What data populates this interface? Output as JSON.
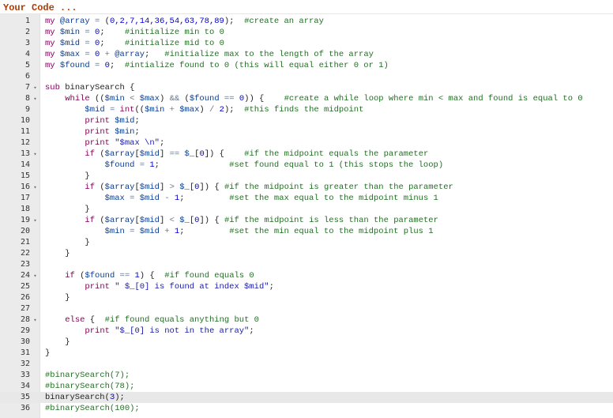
{
  "title": "Your Code ...",
  "active_line": 35,
  "colors": {
    "title": "#b33a00",
    "gutter": "#ebebeb",
    "keyword": "#7f0055",
    "variable": "#0a3d91",
    "number": "#0000cd",
    "comment": "#236e24",
    "string": "#1a1aa6",
    "active_line": "#e8e8e8"
  },
  "lines": [
    {
      "n": "1",
      "fold": false,
      "indent": "",
      "tokens": [
        [
          "kw",
          "my "
        ],
        [
          "var",
          "@array"
        ],
        [
          "op",
          " = "
        ],
        [
          "plain",
          "("
        ],
        [
          "num",
          "0,2,7,14,36,54,63,78,89"
        ],
        [
          "plain",
          ");  "
        ],
        [
          "cmt",
          "#create an array"
        ]
      ]
    },
    {
      "n": "2",
      "fold": false,
      "indent": "",
      "tokens": [
        [
          "kw",
          "my "
        ],
        [
          "var",
          "$min"
        ],
        [
          "op",
          " = "
        ],
        [
          "num",
          "0"
        ],
        [
          "plain",
          ";    "
        ],
        [
          "cmt",
          "#initialize min to 0"
        ]
      ]
    },
    {
      "n": "3",
      "fold": false,
      "indent": "",
      "tokens": [
        [
          "kw",
          "my "
        ],
        [
          "var",
          "$mid"
        ],
        [
          "op",
          " = "
        ],
        [
          "num",
          "0"
        ],
        [
          "plain",
          ";    "
        ],
        [
          "cmt",
          "#initialize mid to 0"
        ]
      ]
    },
    {
      "n": "4",
      "fold": false,
      "indent": "",
      "tokens": [
        [
          "kw",
          "my "
        ],
        [
          "var",
          "$max"
        ],
        [
          "op",
          " = "
        ],
        [
          "num",
          "0"
        ],
        [
          "op",
          " + "
        ],
        [
          "var",
          "@array"
        ],
        [
          "plain",
          ";   "
        ],
        [
          "cmt",
          "#initialize max to the length of the array"
        ]
      ]
    },
    {
      "n": "5",
      "fold": false,
      "indent": "",
      "tokens": [
        [
          "kw",
          "my "
        ],
        [
          "var",
          "$found"
        ],
        [
          "op",
          " = "
        ],
        [
          "num",
          "0"
        ],
        [
          "plain",
          ";  "
        ],
        [
          "cmt",
          "#intialize found to 0 (this will equal either 0 or 1)"
        ]
      ]
    },
    {
      "n": "6",
      "fold": false,
      "indent": "",
      "tokens": []
    },
    {
      "n": "7",
      "fold": true,
      "indent": "",
      "tokens": [
        [
          "kw",
          "sub "
        ],
        [
          "fn",
          "binarySearch "
        ],
        [
          "plain",
          "{"
        ]
      ]
    },
    {
      "n": "8",
      "fold": true,
      "indent": "    ",
      "tokens": [
        [
          "kw",
          "while "
        ],
        [
          "plain",
          "(("
        ],
        [
          "var",
          "$min"
        ],
        [
          "op",
          " < "
        ],
        [
          "var",
          "$max"
        ],
        [
          "plain",
          ") "
        ],
        [
          "op",
          "&&"
        ],
        [
          "plain",
          " ("
        ],
        [
          "var",
          "$found"
        ],
        [
          "op",
          " == "
        ],
        [
          "num",
          "0"
        ],
        [
          "plain",
          ")) {    "
        ],
        [
          "cmt",
          "#create a while loop where min < max and found is equal to 0"
        ]
      ]
    },
    {
      "n": "9",
      "fold": false,
      "indent": "        ",
      "tokens": [
        [
          "var",
          "$mid"
        ],
        [
          "op",
          " = "
        ],
        [
          "kw",
          "int"
        ],
        [
          "plain",
          "(("
        ],
        [
          "var",
          "$min"
        ],
        [
          "op",
          " + "
        ],
        [
          "var",
          "$max"
        ],
        [
          "plain",
          ") "
        ],
        [
          "op",
          "/"
        ],
        [
          "num",
          " 2"
        ],
        [
          "plain",
          ");  "
        ],
        [
          "cmt",
          "#this finds the midpoint"
        ]
      ]
    },
    {
      "n": "10",
      "fold": false,
      "indent": "        ",
      "tokens": [
        [
          "kw",
          "print "
        ],
        [
          "var",
          "$mid"
        ],
        [
          "plain",
          ";"
        ]
      ]
    },
    {
      "n": "11",
      "fold": false,
      "indent": "        ",
      "tokens": [
        [
          "kw",
          "print "
        ],
        [
          "var",
          "$min"
        ],
        [
          "plain",
          ";"
        ]
      ]
    },
    {
      "n": "12",
      "fold": false,
      "indent": "        ",
      "tokens": [
        [
          "kw",
          "print "
        ],
        [
          "str",
          "\"$max \\n\""
        ],
        [
          "plain",
          ";"
        ]
      ]
    },
    {
      "n": "13",
      "fold": true,
      "indent": "        ",
      "tokens": [
        [
          "kw",
          "if "
        ],
        [
          "plain",
          "("
        ],
        [
          "var",
          "$array"
        ],
        [
          "plain",
          "["
        ],
        [
          "var",
          "$mid"
        ],
        [
          "plain",
          "]"
        ],
        [
          "op",
          " == "
        ],
        [
          "var",
          "$_"
        ],
        [
          "plain",
          "["
        ],
        [
          "num",
          "0"
        ],
        [
          "plain",
          "]) {    "
        ],
        [
          "cmt",
          "#if the midpoint equals the parameter"
        ]
      ]
    },
    {
      "n": "14",
      "fold": false,
      "indent": "            ",
      "tokens": [
        [
          "var",
          "$found"
        ],
        [
          "op",
          " = "
        ],
        [
          "num",
          "1"
        ],
        [
          "plain",
          ";              "
        ],
        [
          "cmt",
          "#set found equal to 1 (this stops the loop)"
        ]
      ]
    },
    {
      "n": "15",
      "fold": false,
      "indent": "        ",
      "tokens": [
        [
          "plain",
          "}"
        ]
      ]
    },
    {
      "n": "16",
      "fold": true,
      "indent": "        ",
      "tokens": [
        [
          "kw",
          "if "
        ],
        [
          "plain",
          "("
        ],
        [
          "var",
          "$array"
        ],
        [
          "plain",
          "["
        ],
        [
          "var",
          "$mid"
        ],
        [
          "plain",
          "]"
        ],
        [
          "op",
          " > "
        ],
        [
          "var",
          "$_"
        ],
        [
          "plain",
          "["
        ],
        [
          "num",
          "0"
        ],
        [
          "plain",
          "]) { "
        ],
        [
          "cmt",
          "#if the midpoint is greater than the parameter"
        ]
      ]
    },
    {
      "n": "17",
      "fold": false,
      "indent": "            ",
      "tokens": [
        [
          "var",
          "$max"
        ],
        [
          "op",
          " = "
        ],
        [
          "var",
          "$mid"
        ],
        [
          "op",
          " - "
        ],
        [
          "num",
          "1"
        ],
        [
          "plain",
          ";         "
        ],
        [
          "cmt",
          "#set the max equal to the midpoint minus 1"
        ]
      ]
    },
    {
      "n": "18",
      "fold": false,
      "indent": "        ",
      "tokens": [
        [
          "plain",
          "}"
        ]
      ]
    },
    {
      "n": "19",
      "fold": true,
      "indent": "        ",
      "tokens": [
        [
          "kw",
          "if "
        ],
        [
          "plain",
          "("
        ],
        [
          "var",
          "$array"
        ],
        [
          "plain",
          "["
        ],
        [
          "var",
          "$mid"
        ],
        [
          "plain",
          "]"
        ],
        [
          "op",
          " < "
        ],
        [
          "var",
          "$_"
        ],
        [
          "plain",
          "["
        ],
        [
          "num",
          "0"
        ],
        [
          "plain",
          "]) { "
        ],
        [
          "cmt",
          "#if the midpoint is less than the parameter"
        ]
      ]
    },
    {
      "n": "20",
      "fold": false,
      "indent": "            ",
      "tokens": [
        [
          "var",
          "$min"
        ],
        [
          "op",
          " = "
        ],
        [
          "var",
          "$mid"
        ],
        [
          "op",
          " + "
        ],
        [
          "num",
          "1"
        ],
        [
          "plain",
          ";         "
        ],
        [
          "cmt",
          "#set the min equal to the midpoint plus 1"
        ]
      ]
    },
    {
      "n": "21",
      "fold": false,
      "indent": "        ",
      "tokens": [
        [
          "plain",
          "}"
        ]
      ]
    },
    {
      "n": "22",
      "fold": false,
      "indent": "    ",
      "tokens": [
        [
          "plain",
          "}"
        ]
      ]
    },
    {
      "n": "23",
      "fold": false,
      "indent": "",
      "tokens": []
    },
    {
      "n": "24",
      "fold": true,
      "indent": "    ",
      "tokens": [
        [
          "kw",
          "if "
        ],
        [
          "plain",
          "("
        ],
        [
          "var",
          "$found"
        ],
        [
          "op",
          " == "
        ],
        [
          "num",
          "1"
        ],
        [
          "plain",
          ") {  "
        ],
        [
          "cmt",
          "#if found equals 0"
        ]
      ]
    },
    {
      "n": "25",
      "fold": false,
      "indent": "        ",
      "tokens": [
        [
          "kw",
          "print "
        ],
        [
          "str",
          "\" $_[0] is found at index $mid\""
        ],
        [
          "plain",
          ";"
        ]
      ]
    },
    {
      "n": "26",
      "fold": false,
      "indent": "    ",
      "tokens": [
        [
          "plain",
          "}"
        ]
      ]
    },
    {
      "n": "27",
      "fold": false,
      "indent": "",
      "tokens": []
    },
    {
      "n": "28",
      "fold": true,
      "indent": "    ",
      "tokens": [
        [
          "kw",
          "else "
        ],
        [
          "plain",
          "{  "
        ],
        [
          "cmt",
          "#if found equals anything but 0"
        ]
      ]
    },
    {
      "n": "29",
      "fold": false,
      "indent": "        ",
      "tokens": [
        [
          "kw",
          "print "
        ],
        [
          "str",
          "\"$_[0] is not in the array\""
        ],
        [
          "plain",
          ";"
        ]
      ]
    },
    {
      "n": "30",
      "fold": false,
      "indent": "    ",
      "tokens": [
        [
          "plain",
          "}"
        ]
      ]
    },
    {
      "n": "31",
      "fold": false,
      "indent": "",
      "tokens": [
        [
          "plain",
          "}"
        ]
      ]
    },
    {
      "n": "32",
      "fold": false,
      "indent": "",
      "tokens": []
    },
    {
      "n": "33",
      "fold": false,
      "indent": "",
      "tokens": [
        [
          "cmt",
          "#binarySearch(7);"
        ]
      ]
    },
    {
      "n": "34",
      "fold": false,
      "indent": "",
      "tokens": [
        [
          "cmt",
          "#binarySearch(78);"
        ]
      ]
    },
    {
      "n": "35",
      "fold": false,
      "indent": "",
      "tokens": [
        [
          "fn",
          "binarySearch"
        ],
        [
          "plain",
          "("
        ],
        [
          "num",
          "3"
        ],
        [
          "plain",
          ");"
        ]
      ]
    },
    {
      "n": "36",
      "fold": false,
      "indent": "",
      "tokens": [
        [
          "cmt",
          "#binarySearch(100);"
        ]
      ]
    }
  ]
}
